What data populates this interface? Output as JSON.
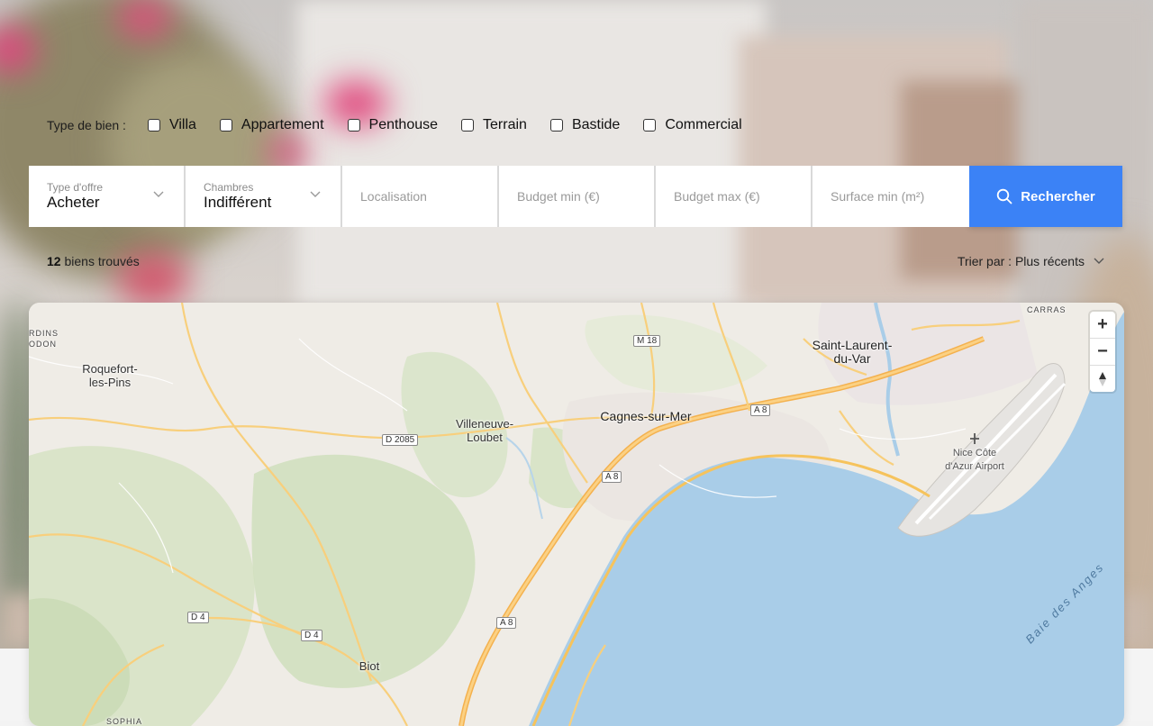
{
  "filters": {
    "type_label": "Type de bien :",
    "property_types": [
      "Villa",
      "Appartement",
      "Penthouse",
      "Terrain",
      "Bastide",
      "Commercial"
    ]
  },
  "search": {
    "offer_label": "Type d'offre",
    "offer_value": "Acheter",
    "rooms_label": "Chambres",
    "rooms_value": "Indifférent",
    "location_placeholder": "Localisation",
    "budget_min_placeholder": "Budget min (€)",
    "budget_max_placeholder": "Budget max (€)",
    "surface_min_placeholder": "Surface min (m²)",
    "submit_label": "Rechercher"
  },
  "results": {
    "count": "12",
    "count_suffix": "biens trouvés",
    "sort_label": "Trier par : Plus récents"
  },
  "map": {
    "places": {
      "saint_laurent": "Saint-Laurent-du-Var",
      "cagnes": "Cagnes-sur-Mer",
      "villeneuve": "Villeneuve-Loubet",
      "roquefort": "Roquefort-les-Pins",
      "biot": "Biot",
      "airport": "Nice Côte d'Azur Airport",
      "baie": "Baie des Anges",
      "carras": "CARRAS",
      "rdins": "RDINS",
      "odon": "ODON",
      "sophia": "SOPHIA"
    },
    "roads": [
      "M 18",
      "A 8",
      "D 2085",
      "A 8",
      "D 4",
      "D 4",
      "A 8"
    ],
    "zoom_in": "+",
    "zoom_out": "−"
  },
  "colors": {
    "accent": "#3b82f6",
    "sea": "#a9cde8",
    "land": "#efece6",
    "road": "#f7c35a"
  }
}
